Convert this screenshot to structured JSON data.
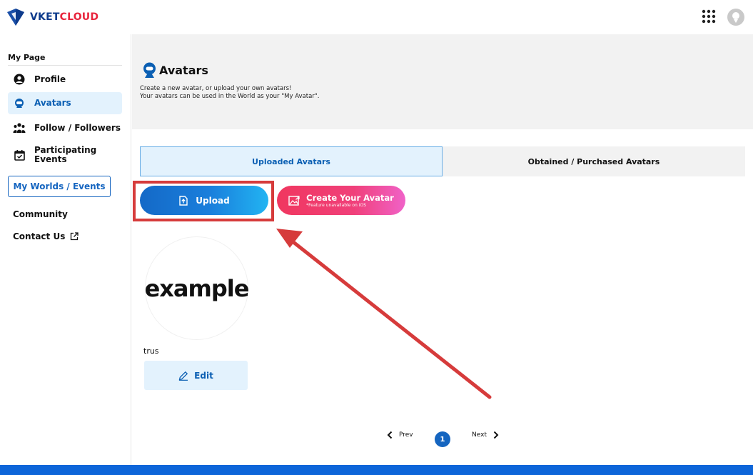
{
  "header": {
    "logo": {
      "part1": "VKET",
      "part2": "CLOUD"
    },
    "icons": [
      "apps-grid-icon",
      "user-avatar-icon"
    ]
  },
  "sidebar": {
    "section_label": "My Page",
    "items": [
      {
        "label": "Profile",
        "icon": "user-circle-icon",
        "active": false
      },
      {
        "label": "Avatars",
        "icon": "avatar-icon",
        "active": true
      },
      {
        "label": "Follow / Followers",
        "icon": "people-icon",
        "active": false
      },
      {
        "label": "Participating Events",
        "line1": "Participating",
        "line2": "Events",
        "icon": "calendar-check-icon",
        "active": false
      }
    ],
    "my_worlds_button": "My Worlds / Events",
    "community_link": "Community",
    "contact_link": "Contact Us",
    "contact_icon": "external-link-icon"
  },
  "hero": {
    "title": "Avatars",
    "desc_line1": "Create a new avatar, or upload your own avatars!",
    "desc_line2": "Your avatars can be used in the World as your \"My Avatar\"."
  },
  "tabs": {
    "uploaded": "Uploaded Avatars",
    "obtained": "Obtained / Purchased Avatars",
    "active": "uploaded"
  },
  "actions": {
    "upload_label": "Upload",
    "create_label": "Create Your Avatar",
    "create_note": "*Feature unavailable on iOS"
  },
  "avatar_card": {
    "thumbnail_text": "example",
    "name": "trus",
    "edit_label": "Edit"
  },
  "pagination": {
    "prev_label": "Prev",
    "current_page": "1",
    "next_label": "Next"
  },
  "colors": {
    "primary": "#1565c0",
    "active_bg": "#e3f2fd",
    "annotation": "#d63b3b",
    "footer": "#0d65d9",
    "brand_navy": "#0d3b8c",
    "brand_red": "#e8243c"
  }
}
